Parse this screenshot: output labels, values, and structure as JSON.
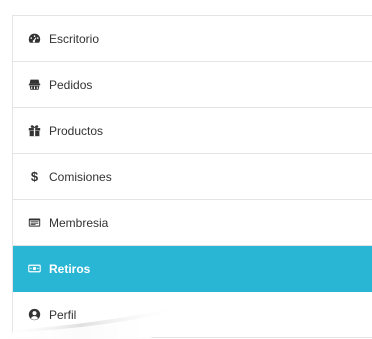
{
  "menu": {
    "items": [
      {
        "label": "Escritorio",
        "icon": "dashboard-icon",
        "active": false
      },
      {
        "label": "Pedidos",
        "icon": "shopping-basket-icon",
        "active": false
      },
      {
        "label": "Productos",
        "icon": "gift-icon",
        "active": false
      },
      {
        "label": "Comisiones",
        "icon": "dollar-icon",
        "active": false
      },
      {
        "label": "Membresia",
        "icon": "card-icon",
        "active": false
      },
      {
        "label": "Retiros",
        "icon": "money-bill-icon",
        "active": true
      },
      {
        "label": "Perfil",
        "icon": "user-circle-icon",
        "active": false
      }
    ]
  },
  "colors": {
    "active_bg": "#29b6d5",
    "text": "#333333",
    "border": "#e4e4e4"
  }
}
